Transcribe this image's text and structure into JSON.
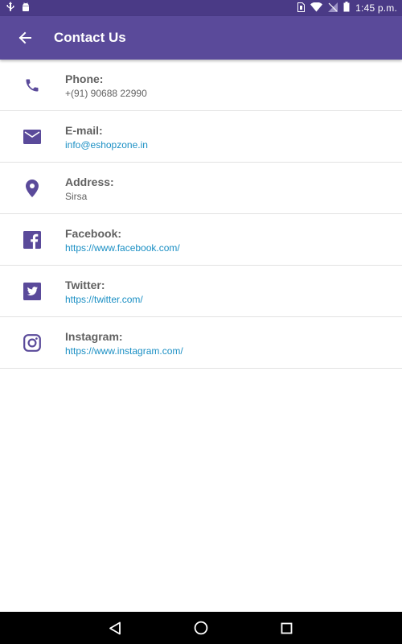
{
  "status_bar": {
    "time": "1:45 p.m.",
    "icons": [
      "usb-icon",
      "android-icon",
      "sim-icon",
      "wifi-icon",
      "no-signal-icon",
      "battery-icon"
    ]
  },
  "app_bar": {
    "title": "Contact Us",
    "background": "#5a4a9a",
    "status_background": "#4a3a86"
  },
  "contacts": [
    {
      "icon": "phone-icon",
      "label": "Phone:",
      "value": "+(91) 90688 22990",
      "is_link": false
    },
    {
      "icon": "email-icon",
      "label": "E-mail:",
      "value": "info@eshopzone.in",
      "is_link": true
    },
    {
      "icon": "location-icon",
      "label": "Address:",
      "value": "Sirsa",
      "is_link": false
    },
    {
      "icon": "facebook-icon",
      "label": "Facebook:",
      "value": "https://www.facebook.com/",
      "is_link": true
    },
    {
      "icon": "twitter-icon",
      "label": "Twitter:",
      "value": "https://twitter.com/",
      "is_link": true
    },
    {
      "icon": "instagram-icon",
      "label": "Instagram:",
      "value": "https://www.instagram.com/",
      "is_link": true
    }
  ],
  "colors": {
    "accent": "#5a4a9a",
    "icon": "#5a4a9a",
    "link": "#1a8fc4",
    "text": "#616161"
  },
  "nav_bar": {
    "icons": [
      "back-triangle-icon",
      "home-circle-icon",
      "recents-square-icon"
    ]
  }
}
